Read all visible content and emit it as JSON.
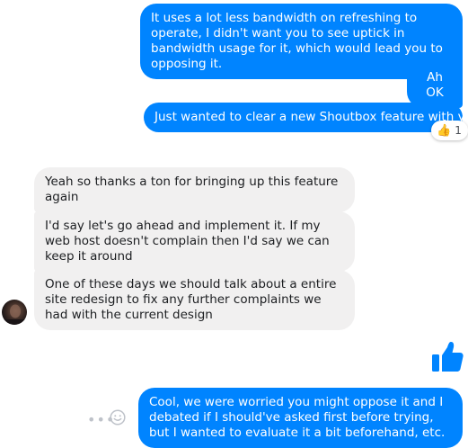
{
  "messages": [
    {
      "id": "b1",
      "sender": "me",
      "text": "It uses a lot less bandwidth on refreshing to operate, I didn't want you to see uptick in bandwidth usage for it, which would lead you to opposing it."
    },
    {
      "id": "b2",
      "sender": "me",
      "text": "Ah OK"
    },
    {
      "id": "b3",
      "sender": "me",
      "text": "Just wanted to clear a new Shoutbox feature with you."
    },
    {
      "id": "b4",
      "sender": "other",
      "text": "Yeah so thanks a ton for bringing up this feature again"
    },
    {
      "id": "b5",
      "sender": "other",
      "text": "I'd say let's go ahead and implement it. If my web host doesn't complain then I'd say we can keep it around"
    },
    {
      "id": "b6",
      "sender": "other",
      "text": "One of these days we should talk about a entire site redesign to fix any further complaints we had with the current design"
    },
    {
      "id": "b7",
      "sender": "me",
      "text": "Cool, we were worried you might oppose it and I debated if I should've asked first before trying, but I wanted to evaluate it a bit beforehand, etc."
    }
  ],
  "reaction": {
    "emoji": "👍",
    "count": "1"
  },
  "icons": {
    "reaction_emoji": "thumbs-up-emoji",
    "big_like": "thumbs-up-icon",
    "more": "more-dots-icon",
    "emoji_picker": "smile-icon"
  },
  "colors": {
    "outgoing": "#0084ff",
    "incoming": "#f1f0f0",
    "like": "#0084ff"
  }
}
